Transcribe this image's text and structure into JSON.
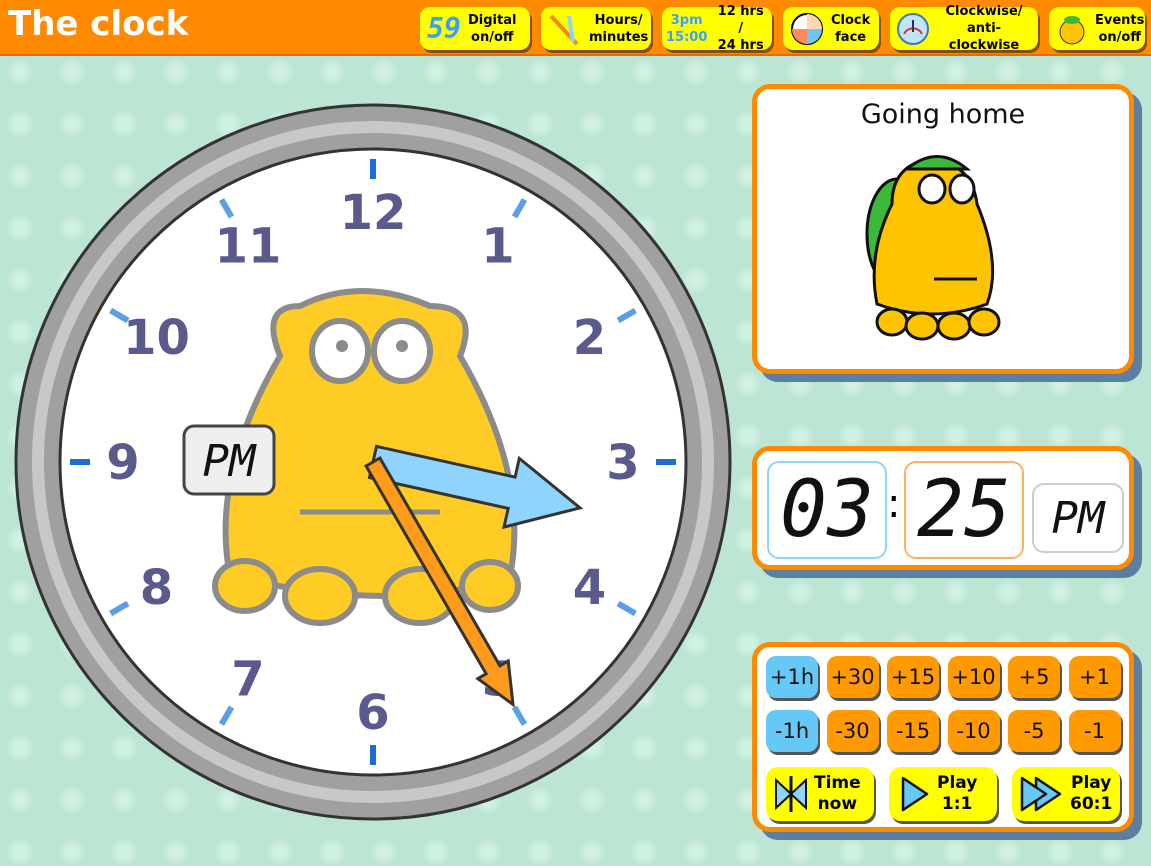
{
  "header": {
    "title": "The clock",
    "buttons": [
      {
        "icon": "digital-59-icon",
        "icon_text": "59",
        "label1": "Digital",
        "label2": "on/off"
      },
      {
        "icon": "clock-hands-icon",
        "label1": "Hours/",
        "label2": "minutes"
      },
      {
        "icon": "time-format-icon",
        "icon_text1": "3pm",
        "icon_text2": "15:00",
        "label1": "12 hrs /",
        "label2": "24 hrs"
      },
      {
        "icon": "clock-face-icon",
        "label1": "Clock",
        "label2": "face"
      },
      {
        "icon": "gauge-icon",
        "label1": "Clockwise/",
        "label2": "anti-clockwise"
      },
      {
        "icon": "character-icon",
        "label1": "Events",
        "label2": "on/off"
      }
    ]
  },
  "clock": {
    "hours": 3,
    "minutes": 25,
    "ampm": "PM",
    "numbers": [
      "12",
      "1",
      "2",
      "3",
      "4",
      "5",
      "6",
      "7",
      "8",
      "9",
      "10",
      "11"
    ],
    "colors": {
      "hour_hand": "#8fd3ff",
      "minute_hand": "#ff9a1a",
      "numbers": "#5a5a8c"
    }
  },
  "event": {
    "title": "Going home"
  },
  "digital": {
    "hours": "03",
    "minutes": "25",
    "ampm": "PM",
    "separator": ":"
  },
  "controls": {
    "plus": [
      "+1h",
      "+30",
      "+15",
      "+10",
      "+5",
      "+1"
    ],
    "minus": [
      "-1h",
      "-30",
      "-15",
      "-10",
      "-5",
      "-1"
    ],
    "time_now": {
      "label1": "Time",
      "label2": "now"
    },
    "play1": {
      "label1": "Play",
      "label2": "1:1"
    },
    "play60": {
      "label1": "Play",
      "label2": "60:1"
    }
  }
}
